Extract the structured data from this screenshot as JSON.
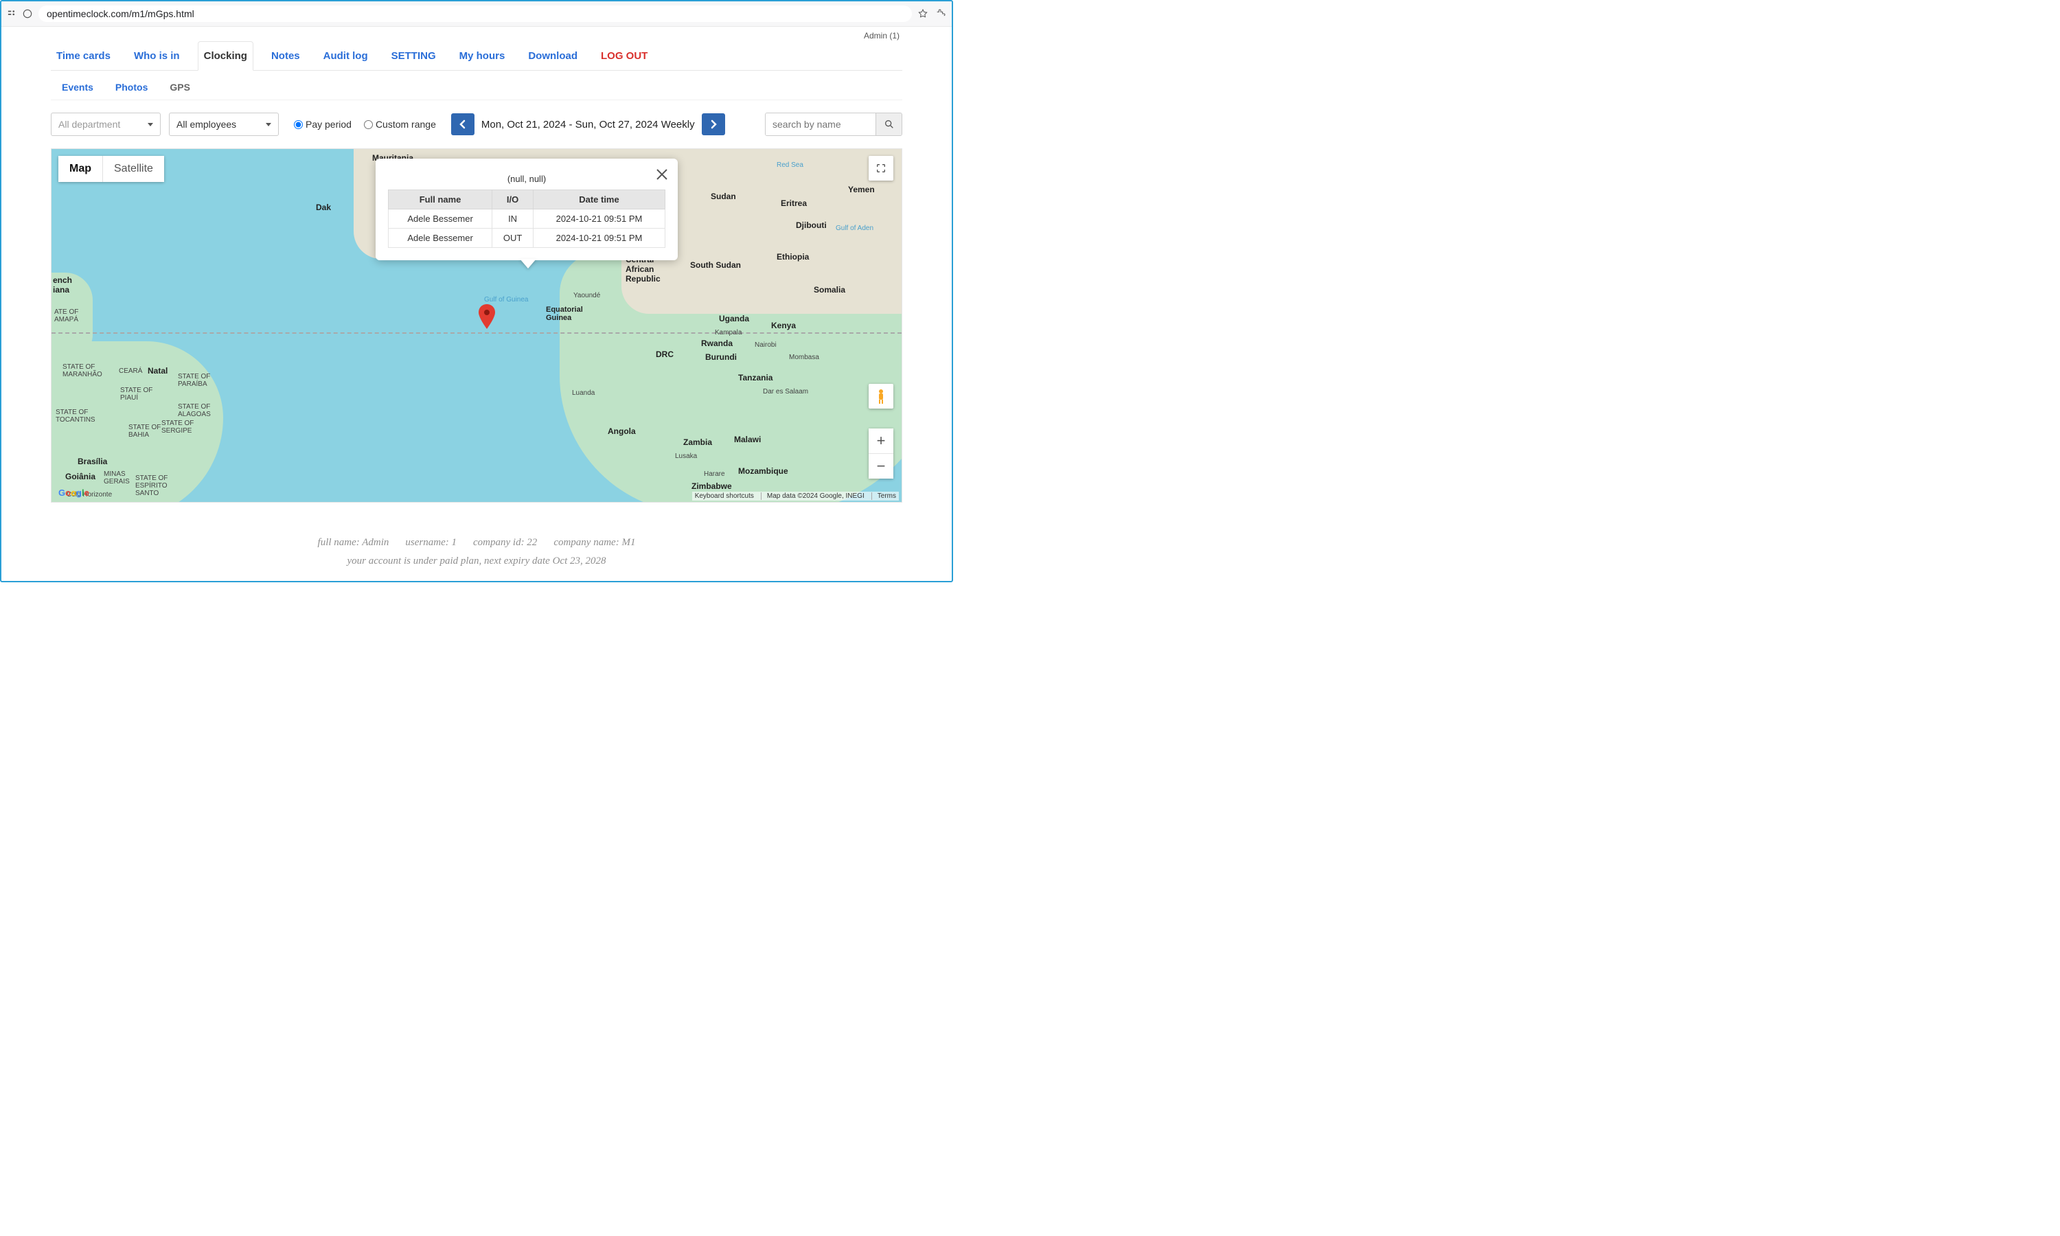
{
  "browser": {
    "url": "opentimeclock.com/m1/mGps.html"
  },
  "header": {
    "admin_label": "Admin (1)"
  },
  "nav": {
    "items": [
      {
        "label": "Time cards",
        "active": false
      },
      {
        "label": "Who is in",
        "active": false
      },
      {
        "label": "Clocking",
        "active": true
      },
      {
        "label": "Notes",
        "active": false
      },
      {
        "label": "Audit log",
        "active": false
      },
      {
        "label": "SETTING",
        "active": false
      },
      {
        "label": "My hours",
        "active": false
      },
      {
        "label": "Download",
        "active": false
      },
      {
        "label": "LOG OUT",
        "active": false
      }
    ],
    "sub": [
      {
        "label": "Events",
        "active": false
      },
      {
        "label": "Photos",
        "active": false
      },
      {
        "label": "GPS",
        "active": true
      }
    ]
  },
  "toolbar": {
    "department": "All department",
    "employees": "All employees",
    "range": {
      "payperiod_label": "Pay period",
      "custom_label": "Custom range",
      "date_text": "Mon, Oct 21, 2024 - Sun, Oct 27, 2024 Weekly"
    },
    "search_placeholder": "search by name"
  },
  "map": {
    "type_map": "Map",
    "type_sat": "Satellite",
    "footer": {
      "shortcuts": "Keyboard shortcuts",
      "data": "Map data ©2024 Google, INEGI",
      "terms": "Terms"
    },
    "labels": {
      "mauritania": "Mauritania",
      "sudan": "Sudan",
      "eritrea": "Eritrea",
      "yemen": "Yemen",
      "redsea": "Red Sea",
      "gulfaden": "Gulf of Aden",
      "ethiopia": "Ethiopia",
      "djibouti": "Djibouti",
      "southsudan": "South Sudan",
      "centralafr": "Central\nAfrican\nRepublic",
      "yaounde": "Yaoundé",
      "gulfguinea": "Gulf of Guinea",
      "eqguinea": "Equatorial\nGuinea",
      "uganda": "Uganda",
      "kenya": "Kenya",
      "somalia": "Somalia",
      "kampala": "Kampala",
      "nairobi": "Nairobi",
      "mombasa": "Mombasa",
      "rwanda": "Rwanda",
      "burundi": "Burundi",
      "drc": "DRC",
      "tanzania": "Tanzania",
      "dares": "Dar es Salaam",
      "luanda": "Luanda",
      "angola": "Angola",
      "zambia": "Zambia",
      "lusaka": "Lusaka",
      "malawi": "Malawi",
      "harare": "Harare",
      "zimbabwe": "Zimbabwe",
      "mozambique": "Mozambique",
      "dak": "Dak",
      "enchiana": "ench\niana",
      "amapa": "ATE OF\nAMAPÁ",
      "maranhao": "STATE OF\nMARANHÃO",
      "ceara": "CEARÁ",
      "natal": "Natal",
      "paraiba": "STATE OF\nPARAÍBA",
      "piaui": "STATE OF\nPIAUÍ",
      "tocantins": "STATE OF\nTOCANTINS",
      "alagoas": "STATE OF\nALAGOAS",
      "sergipe": "STATE OF\nSERGIPE",
      "bahia": "STATE OF\nBAHIA",
      "brasilia": "Brasília",
      "goiania": "Goiânia",
      "minas": "MINAS\nGERAIS",
      "espirito": "STATE OF\nESPÍRITO\nSANTO",
      "horizonte": "Colo Horizonte"
    }
  },
  "info": {
    "coord": "(null, null)",
    "headers": {
      "name": "Full name",
      "io": "I/O",
      "dt": "Date time"
    },
    "rows": [
      {
        "name": "Adele Bessemer",
        "io": "IN",
        "dt": "2024-10-21 09:51 PM"
      },
      {
        "name": "Adele Bessemer",
        "io": "OUT",
        "dt": "2024-10-21 09:51 PM"
      }
    ]
  },
  "footer": {
    "fullname_label": "full name: Admin",
    "username_label": "username: 1",
    "company_id_label": "company id: 22",
    "company_name_label": "company name: M1",
    "plan_label": "your account is under paid plan, next expiry date Oct 23, 2028"
  }
}
